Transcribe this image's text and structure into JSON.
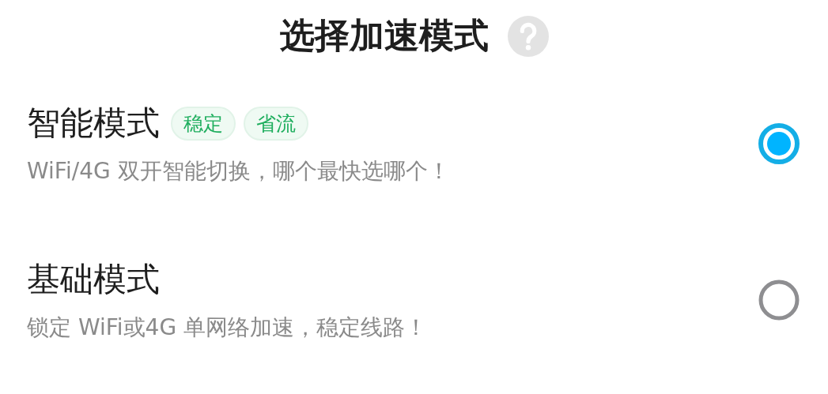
{
  "title": "选择加速模式",
  "modes": [
    {
      "name": "智能模式",
      "tags": [
        "稳定",
        "省流"
      ],
      "description": "WiFi/4G 双开智能切换，哪个最快选哪个！",
      "selected": true
    },
    {
      "name": "基础模式",
      "description": "锁定 WiFi或4G 单网络加速，稳定线路！",
      "selected": false
    }
  ]
}
